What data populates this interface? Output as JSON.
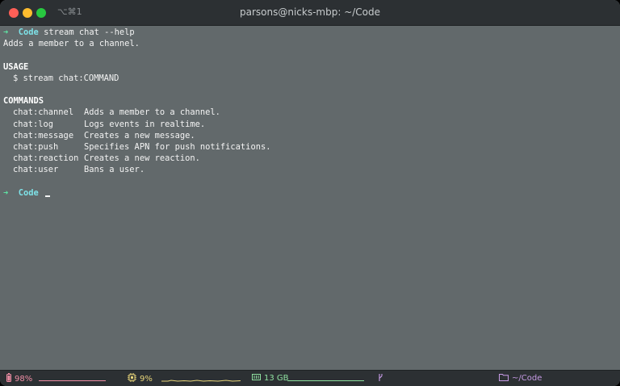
{
  "window": {
    "shortcut": "⌥⌘1",
    "title": "parsons@nicks-mbp: ~/Code"
  },
  "terminal": {
    "prompt_arrow": "➜",
    "prompt_dir": "Code",
    "command": "stream chat --help",
    "description": "Adds a member to a channel.",
    "usage_heading": "USAGE",
    "usage_line": "$ stream chat:COMMAND",
    "commands_heading": "COMMANDS",
    "commands": [
      {
        "name": "chat:channel",
        "desc": "Adds a member to a channel."
      },
      {
        "name": "chat:log",
        "desc": "Logs events in realtime."
      },
      {
        "name": "chat:message",
        "desc": "Creates a new message."
      },
      {
        "name": "chat:push",
        "desc": "Specifies APN for push notifications."
      },
      {
        "name": "chat:reaction",
        "desc": "Creates a new reaction."
      },
      {
        "name": "chat:user",
        "desc": "Bans a user."
      }
    ]
  },
  "statusbar": {
    "battery": "98%",
    "cpu": "9%",
    "memory": "13 GB",
    "path": "~/Code",
    "battery_level": 0.98,
    "cpu_level": 0.09,
    "icons": {
      "battery": "battery-icon",
      "cpu": "cpu-icon",
      "memory": "memory-icon",
      "branch": "git-branch-icon",
      "folder": "folder-icon"
    },
    "colors": {
      "battery": "#ef8ea5",
      "cpu": "#e8d57a",
      "memory": "#8fe0a0",
      "branch": "#c79be6",
      "path": "#c79be6"
    }
  },
  "colors": {
    "terminal_bg": "#62696b",
    "titlebar_bg": "#2c3033",
    "prompt_arrow": "#5fe2a3",
    "prompt_dir": "#7ee2e8"
  }
}
